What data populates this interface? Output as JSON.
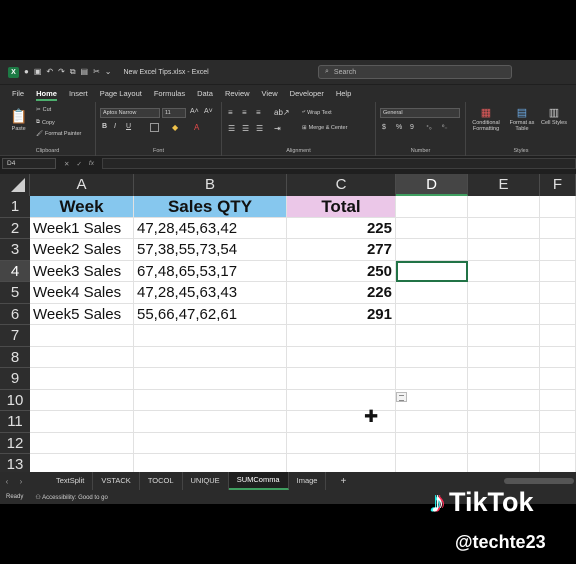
{
  "titlebar": {
    "doc_title": "New Excel Tips.xlsx  -  Excel",
    "search_placeholder": "Search"
  },
  "menu": {
    "tabs": [
      "File",
      "Home",
      "Insert",
      "Page Layout",
      "Formulas",
      "Data",
      "Review",
      "View",
      "Developer",
      "Help"
    ],
    "active": "Home"
  },
  "ribbon": {
    "clipboard": {
      "paste": "Paste",
      "cut": "Cut",
      "copy": "Copy",
      "format_painter": "Format Painter",
      "label": "Clipboard"
    },
    "font": {
      "name": "Aptos Narrow",
      "size": "11",
      "label": "Font",
      "bold": "B",
      "italic": "I",
      "underline": "U"
    },
    "alignment": {
      "wrap": "Wrap Text",
      "merge": "Merge & Center",
      "label": "Alignment"
    },
    "number": {
      "format": "General",
      "label": "Number",
      "currency": "$",
      "percent": "%",
      "comma": "9"
    },
    "styles": {
      "conditional": "Conditional Formatting",
      "format_table": "Format as Table",
      "cell_styles": "Cell Styles",
      "label": "Styles"
    }
  },
  "formula_bar": {
    "name_box": "D4",
    "fx": "fx"
  },
  "grid": {
    "columns": [
      "A",
      "B",
      "C",
      "D",
      "E",
      "F"
    ],
    "selected_column": "D",
    "rows": [
      "1",
      "2",
      "3",
      "4",
      "5",
      "6",
      "7",
      "8",
      "9",
      "10",
      "11",
      "12",
      "13"
    ],
    "selected_row": "4",
    "headers": {
      "a": "Week",
      "b": "Sales QTY",
      "c": "Total"
    },
    "data": [
      {
        "week": "Week1 Sales",
        "sales": "47,28,45,63,42",
        "total": "225"
      },
      {
        "week": "Week2 Sales",
        "sales": "57,38,55,73,54",
        "total": "277"
      },
      {
        "week": "Week3 Sales",
        "sales": "67,48,65,53,17",
        "total": "250"
      },
      {
        "week": "Week4 Sales",
        "sales": "47,28,45,63,43",
        "total": "226"
      },
      {
        "week": "Week5 Sales",
        "sales": "55,66,47,62,61",
        "total": "291"
      }
    ]
  },
  "sheets": {
    "tabs": [
      "TextSplit",
      "VSTACK",
      "TOCOL",
      "UNIQUE",
      "SUMComma",
      "Image"
    ],
    "active": "SUMComma",
    "add": "+"
  },
  "status": {
    "ready": "Ready",
    "accessibility": "Accessibility: Good to go"
  },
  "overlay": {
    "brand": "TikTok",
    "handle": "@techte23"
  },
  "colors": {
    "header_blue": "#86c7ee",
    "header_pink": "#ebc7e8",
    "excel_green": "#217346"
  }
}
